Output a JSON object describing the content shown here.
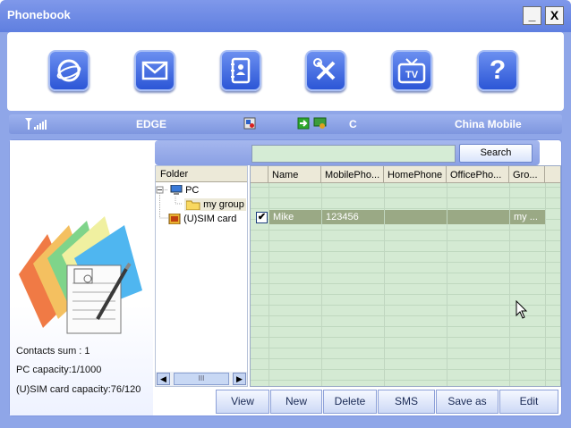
{
  "window": {
    "title": "Phonebook",
    "minimize": "_",
    "close": "X"
  },
  "toolbar": {
    "icons": [
      "internet-icon",
      "mail-icon",
      "contacts-book-icon",
      "tools-icon",
      "tv-icon",
      "help-icon"
    ],
    "tv_label": "TV",
    "help_label": "?"
  },
  "status": {
    "network_type": "EDGE",
    "connection": "C",
    "operator": "China Mobile"
  },
  "search": {
    "value": "",
    "button_label": "Search"
  },
  "folder": {
    "header": "Folder",
    "items": [
      {
        "label": "PC"
      },
      {
        "label": "my group"
      },
      {
        "label": "(U)SIM card"
      }
    ],
    "scroll_thumb": "III"
  },
  "table": {
    "columns": [
      "Name",
      "MobilePho...",
      "HomePhone",
      "OfficePho...",
      "Gro..."
    ],
    "rows": [
      {
        "checked": "✔",
        "name": "Mike",
        "mobile": "123456",
        "home": "",
        "office": "",
        "group": "my ..."
      }
    ]
  },
  "summary": {
    "contacts_sum": "Contacts sum : 1",
    "pc_capacity": "PC capacity:1/1000",
    "sim_capacity": "(U)SIM card capacity:76/120"
  },
  "buttons": {
    "view": "View",
    "new": "New",
    "delete": "Delete",
    "sms": "SMS",
    "save_as": "Save as",
    "edit": "Edit"
  },
  "colors": {
    "accent": "#5f7fe0",
    "grid_bg": "#d4ead3",
    "selected_row": "#9aa985"
  }
}
